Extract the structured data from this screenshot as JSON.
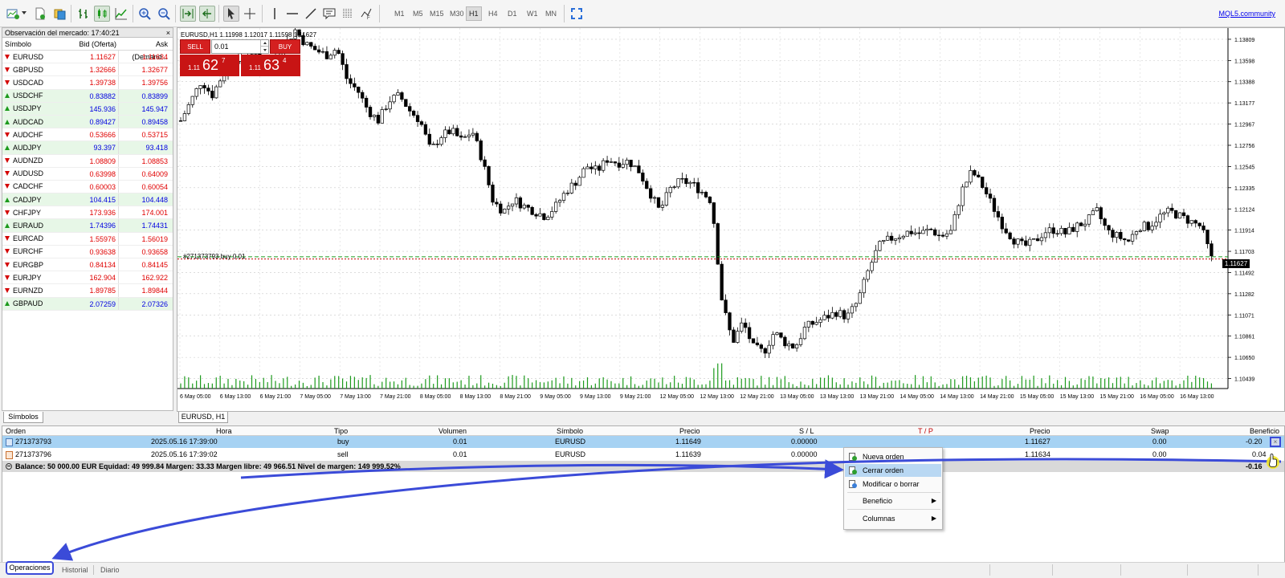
{
  "toolbar": {
    "timeframes": [
      "M1",
      "M5",
      "M15",
      "M30",
      "H1",
      "H4",
      "D1",
      "W1",
      "MN"
    ],
    "active_timeframe": "H1",
    "link": "MQL5.community"
  },
  "market_watch": {
    "title": "Observación del mercado: 17:40:21",
    "close": "×",
    "col_symbol": "Símbolo",
    "col_bid": "Bid (Oferta)",
    "col_ask": "Ask (Demand...",
    "tab": "Símbolos",
    "rows": [
      {
        "symbol": "EURUSD",
        "bid": "1.11627",
        "ask": "1.11634",
        "dir": "down"
      },
      {
        "symbol": "GBPUSD",
        "bid": "1.32666",
        "ask": "1.32677",
        "dir": "down"
      },
      {
        "symbol": "USDCAD",
        "bid": "1.39738",
        "ask": "1.39756",
        "dir": "down"
      },
      {
        "symbol": "USDCHF",
        "bid": "0.83882",
        "ask": "0.83899",
        "dir": "up"
      },
      {
        "symbol": "USDJPY",
        "bid": "145.936",
        "ask": "145.947",
        "dir": "up"
      },
      {
        "symbol": "AUDCAD",
        "bid": "0.89427",
        "ask": "0.89458",
        "dir": "up"
      },
      {
        "symbol": "AUDCHF",
        "bid": "0.53666",
        "ask": "0.53715",
        "dir": "down"
      },
      {
        "symbol": "AUDJPY",
        "bid": "93.397",
        "ask": "93.418",
        "dir": "up"
      },
      {
        "symbol": "AUDNZD",
        "bid": "1.08809",
        "ask": "1.08853",
        "dir": "down"
      },
      {
        "symbol": "AUDUSD",
        "bid": "0.63998",
        "ask": "0.64009",
        "dir": "down"
      },
      {
        "symbol": "CADCHF",
        "bid": "0.60003",
        "ask": "0.60054",
        "dir": "down"
      },
      {
        "symbol": "CADJPY",
        "bid": "104.415",
        "ask": "104.448",
        "dir": "up"
      },
      {
        "symbol": "CHFJPY",
        "bid": "173.936",
        "ask": "174.001",
        "dir": "down"
      },
      {
        "symbol": "EURAUD",
        "bid": "1.74396",
        "ask": "1.74431",
        "dir": "up"
      },
      {
        "symbol": "EURCAD",
        "bid": "1.55976",
        "ask": "1.56019",
        "dir": "down"
      },
      {
        "symbol": "EURCHF",
        "bid": "0.93638",
        "ask": "0.93658",
        "dir": "down"
      },
      {
        "symbol": "EURGBP",
        "bid": "0.84134",
        "ask": "0.84145",
        "dir": "down"
      },
      {
        "symbol": "EURJPY",
        "bid": "162.904",
        "ask": "162.922",
        "dir": "down"
      },
      {
        "symbol": "EURNZD",
        "bid": "1.89785",
        "ask": "1.89844",
        "dir": "down"
      },
      {
        "symbol": "GBPAUD",
        "bid": "2.07259",
        "ask": "2.07326",
        "dir": "up"
      }
    ]
  },
  "chart": {
    "info": "EURUSD,H1  1.11998 1.12017 1.11598 1.11627",
    "tab": "EURUSD, H1",
    "sell_label": "SELL",
    "buy_label": "BUY",
    "lot": "0.01",
    "sell_small": "1.11",
    "sell_big": "62",
    "sell_sup": "7",
    "buy_small": "1.11",
    "buy_big": "63",
    "buy_sup": "4",
    "order_label": "#271373793 buy 0.01",
    "price_tag": "1.11627",
    "price_levels": [
      "1.13809",
      "1.13598",
      "1.13388",
      "1.13177",
      "1.12967",
      "1.12756",
      "1.12545",
      "1.12335",
      "1.12124",
      "1.11914",
      "1.11703",
      "1.11492",
      "1.11282",
      "1.11071",
      "1.10861",
      "1.10650",
      "1.10439"
    ],
    "time_labels": [
      "6 May 05:00",
      "6 May 13:00",
      "6 May 21:00",
      "7 May 05:00",
      "7 May 13:00",
      "7 May 21:00",
      "8 May 05:00",
      "8 May 13:00",
      "8 May 21:00",
      "9 May 05:00",
      "9 May 13:00",
      "9 May 21:00",
      "12 May 05:00",
      "12 May 13:00",
      "12 May 21:00",
      "13 May 05:00",
      "13 May 13:00",
      "13 May 21:00",
      "14 May 05:00",
      "14 May 13:00",
      "14 May 21:00",
      "15 May 05:00",
      "15 May 13:00",
      "15 May 21:00",
      "16 May 05:00",
      "16 May 13:00"
    ]
  },
  "chart_data": {
    "type": "candlestick",
    "symbol": "EURUSD",
    "timeframe": "H1",
    "ylim": [
      1.1034,
      1.1392
    ],
    "close_path": [
      1.13,
      1.132,
      1.134,
      1.1325,
      1.1345,
      1.136,
      1.137,
      1.1368,
      1.1355,
      1.136,
      1.1375,
      1.139,
      1.1376,
      1.137,
      1.1365,
      1.1372,
      1.134,
      1.133,
      1.131,
      1.13,
      1.132,
      1.1325,
      1.131,
      1.13,
      1.127,
      1.1285,
      1.129,
      1.128,
      1.129,
      1.126,
      1.122,
      1.121,
      1.1222,
      1.1215,
      1.121,
      1.1205,
      1.1215,
      1.123,
      1.124,
      1.1255,
      1.125,
      1.1262,
      1.1258,
      1.126,
      1.125,
      1.123,
      1.121,
      1.1232,
      1.124,
      1.1238,
      1.123,
      1.122,
      1.112,
      1.108,
      1.11,
      1.1075,
      1.107,
      1.109,
      1.108,
      1.1075,
      1.1095,
      1.11,
      1.1105,
      1.111,
      1.1105,
      1.112,
      1.115,
      1.1175,
      1.1182,
      1.1186,
      1.119,
      1.1188,
      1.1192,
      1.1185,
      1.119,
      1.123,
      1.125,
      1.1235,
      1.1215,
      1.1195,
      1.1182,
      1.1175,
      1.118,
      1.119,
      1.1192,
      1.1188,
      1.1195,
      1.12,
      1.121,
      1.119,
      1.1185,
      1.118,
      1.1195,
      1.1195,
      1.1205,
      1.121,
      1.1205,
      1.12,
      1.1195,
      1.1163
    ]
  },
  "terminal": {
    "headers": [
      "Orden",
      "Hora",
      "Tipo",
      "Volumen",
      "Símbolo",
      "Precio",
      "S / L",
      "T / P",
      "Precio",
      "Swap",
      "Beneficio"
    ],
    "rows": [
      {
        "order": "271373793",
        "time": "2025.05.16 17:39:00",
        "type": "buy",
        "volume": "0.01",
        "symbol": "EURUSD",
        "price": "1.11649",
        "sl": "0.00000",
        "price2": "1.11627",
        "swap": "0.00",
        "profit": "-0.20"
      },
      {
        "order": "271373796",
        "time": "2025.05.16 17:39:02",
        "type": "sell",
        "volume": "0.01",
        "symbol": "EURUSD",
        "price": "1.11639",
        "sl": "0.00000",
        "price2": "1.11634",
        "swap": "0.00",
        "profit": "0.04"
      }
    ],
    "balance_line": "Balance: 50 000.00 EUR  Equidad: 49 999.84  Margen: 33.33  Margen libre: 49 966.51  Nivel de margen: 149 999.52%",
    "total_profit": "-0.16",
    "tabs": [
      "Operaciones",
      "Historial",
      "Diario"
    ]
  },
  "context_menu": {
    "items": [
      "Nueva orden",
      "Cerrar orden",
      "Modificar o borrar",
      "Beneficio",
      "Columnas"
    ],
    "highlighted": "Cerrar orden"
  },
  "colors": {
    "bull": "#1c9a1c",
    "bear": "#d40000",
    "accent": "#3b4bd8",
    "selected_row": "#a6d2f3"
  }
}
